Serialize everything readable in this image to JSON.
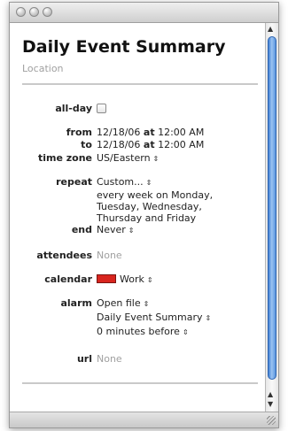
{
  "event": {
    "title": "Daily Event Summary",
    "location_placeholder": "Location"
  },
  "fields": {
    "all_day": {
      "label": "all-day",
      "checked": false
    },
    "from": {
      "label": "from",
      "date": "12/18/06",
      "at": "at",
      "time": "12:00 AM"
    },
    "to": {
      "label": "to",
      "date": "12/18/06",
      "at": "at",
      "time": "12:00 AM"
    },
    "time_zone": {
      "label": "time zone",
      "value": "US/Eastern"
    },
    "repeat": {
      "label": "repeat",
      "value": "Custom...",
      "description_lines": [
        "every week on Monday,",
        "Tuesday, Wednesday,",
        "Thursday and Friday"
      ]
    },
    "end": {
      "label": "end",
      "value": "Never"
    },
    "attendees": {
      "label": "attendees",
      "value": "None"
    },
    "calendar": {
      "label": "calendar",
      "value": "Work",
      "color": "#d8251e"
    },
    "alarm": {
      "label": "alarm",
      "type": "Open file",
      "file": "Daily Event Summary",
      "offset": "0",
      "offset_unit": "minutes before"
    },
    "url": {
      "label": "url",
      "value": "None"
    }
  },
  "icons": {
    "popup_arrow": "⇕",
    "scroll_up": "▲",
    "scroll_down": "▼"
  }
}
